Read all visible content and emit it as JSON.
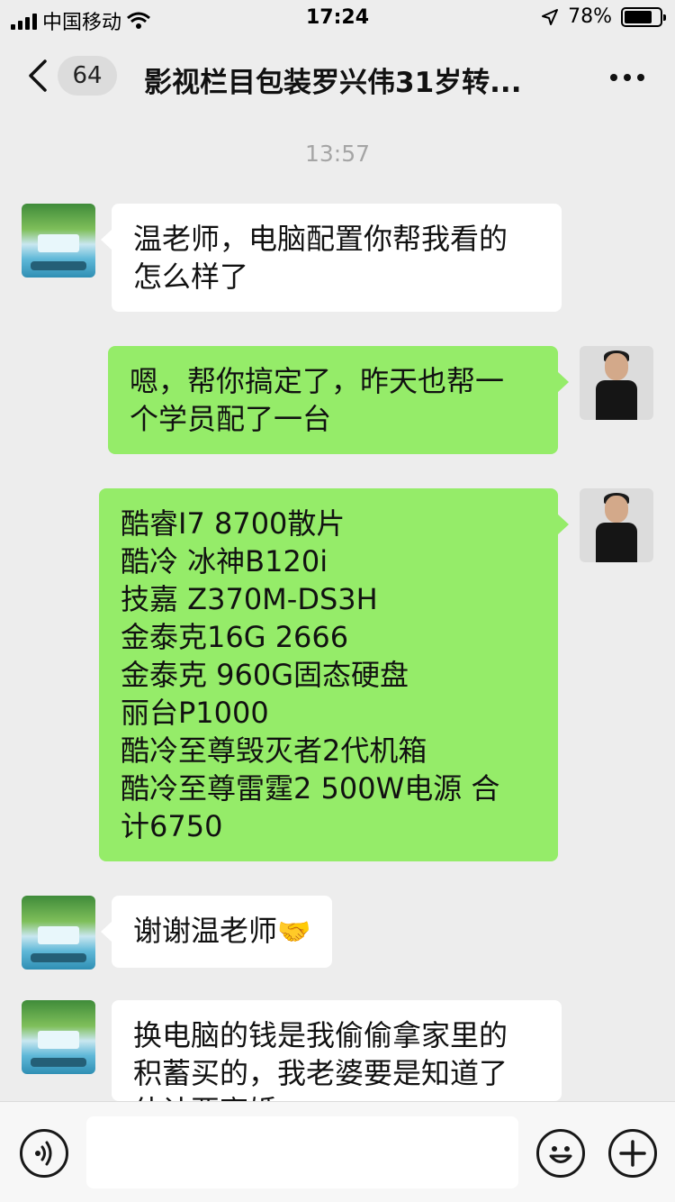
{
  "status_bar": {
    "carrier": "中国移动",
    "time": "17:24",
    "battery_percent": "78%",
    "battery_level": 0.78
  },
  "nav": {
    "unread_count": "64",
    "title": "影视栏目包装罗兴伟31岁转..."
  },
  "chat": {
    "timestamp": "13:57",
    "messages": [
      {
        "side": "left",
        "avatar": "landscape-avatar",
        "lines": [
          "温老师，电脑配置你帮我看的",
          "怎么样了"
        ]
      },
      {
        "side": "right",
        "avatar": "person-avatar",
        "lines": [
          "嗯，帮你搞定了，昨天也帮一",
          "个学员配了一台"
        ]
      },
      {
        "side": "right",
        "avatar": "person-avatar",
        "lines": [
          "酷睿I7 8700散片",
          "酷冷 冰神B120i",
          "技嘉 Z370M-DS3H",
          "金泰克16G 2666",
          "金泰克 960G固态硬盘",
          "丽台P1000",
          "酷冷至尊毁灭者2代机箱",
          "酷冷至尊雷霆2 500W电源   合",
          "计6750"
        ]
      },
      {
        "side": "left",
        "avatar": "landscape-avatar",
        "lines": [
          "谢谢温老师"
        ],
        "emoji": "🤝",
        "emoji_icon": "handshake-icon"
      },
      {
        "side": "left",
        "avatar": "landscape-avatar",
        "lines": [
          "换电脑的钱是我偷偷拿家里的",
          "积蓄买的，我老婆要是知道了",
          "估计要离婚"
        ]
      }
    ]
  },
  "input_bar": {
    "voice_icon": "voice-icon",
    "emoji_icon": "smiley-icon",
    "plus_icon": "plus-icon"
  }
}
